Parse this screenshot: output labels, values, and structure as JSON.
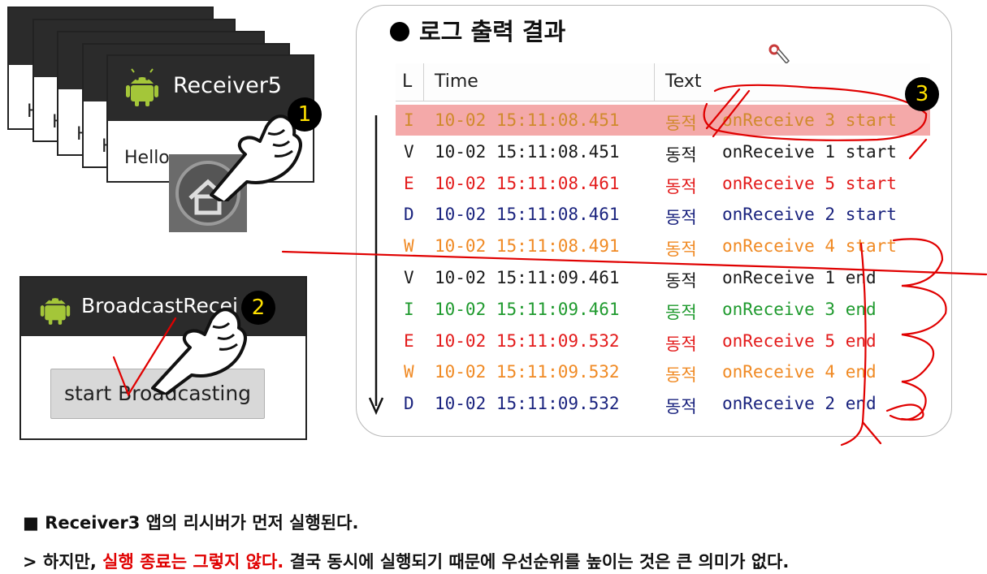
{
  "receivers": {
    "title": "Receiver5",
    "stub_text": "H",
    "body_text": "Hello"
  },
  "broadcast_app": {
    "title": "BroadcastRecei",
    "button_label": "start Broadcasting"
  },
  "badges": [
    "1",
    "2",
    "3"
  ],
  "log_panel": {
    "title": "로그 출력 결과",
    "columns": [
      "L",
      "Time",
      "Text"
    ],
    "rows": [
      {
        "level": "I",
        "time": "10-02 15:11:08.451",
        "tag": "동적",
        "text": "onReceive 3 start",
        "color": "#d08a2c",
        "highlight": true
      },
      {
        "level": "V",
        "time": "10-02 15:11:08.451",
        "tag": "동적",
        "text": "onReceive 1 start",
        "color": "#1a1a1a",
        "highlight": false
      },
      {
        "level": "E",
        "time": "10-02 15:11:08.461",
        "tag": "동적",
        "text": "onReceive 5 start",
        "color": "#e31b1b",
        "highlight": false
      },
      {
        "level": "D",
        "time": "10-02 15:11:08.461",
        "tag": "동적",
        "text": "onReceive 2 start",
        "color": "#1a237e",
        "highlight": false
      },
      {
        "level": "W",
        "time": "10-02 15:11:08.491",
        "tag": "동적",
        "text": "onReceive 4 start",
        "color": "#f08a24",
        "highlight": false
      },
      {
        "level": "V",
        "time": "10-02 15:11:09.461",
        "tag": "동적",
        "text": "onReceive 1 end",
        "color": "#1a1a1a",
        "highlight": false
      },
      {
        "level": "I",
        "time": "10-02 15:11:09.461",
        "tag": "동적",
        "text": "onReceive 3 end",
        "color": "#1f9a2e",
        "highlight": false
      },
      {
        "level": "E",
        "time": "10-02 15:11:09.532",
        "tag": "동적",
        "text": "onReceive 5 end",
        "color": "#e31b1b",
        "highlight": false
      },
      {
        "level": "W",
        "time": "10-02 15:11:09.532",
        "tag": "동적",
        "text": "onReceive 4 end",
        "color": "#f08a24",
        "highlight": false
      },
      {
        "level": "D",
        "time": "10-02 15:11:09.532",
        "tag": "동적",
        "text": "onReceive 2 end",
        "color": "#1a237e",
        "highlight": false
      }
    ]
  },
  "notes": {
    "line1": "■ Receiver3 앱의 리시버가 먼저 실행된다.",
    "line2_prefix": "> 하지만, ",
    "line2_red": "실행 종료는 그렇지 않다.",
    "line2_suffix": " 결국 동시에 실행되기 때문에 우선순위를 높이는 것은 큰 의미가 없다."
  },
  "colors": {
    "badge_bg": "#000000",
    "badge_fg": "#ffe000",
    "highlight_row": "#f4a9a9",
    "annotation_red": "#e00000"
  }
}
